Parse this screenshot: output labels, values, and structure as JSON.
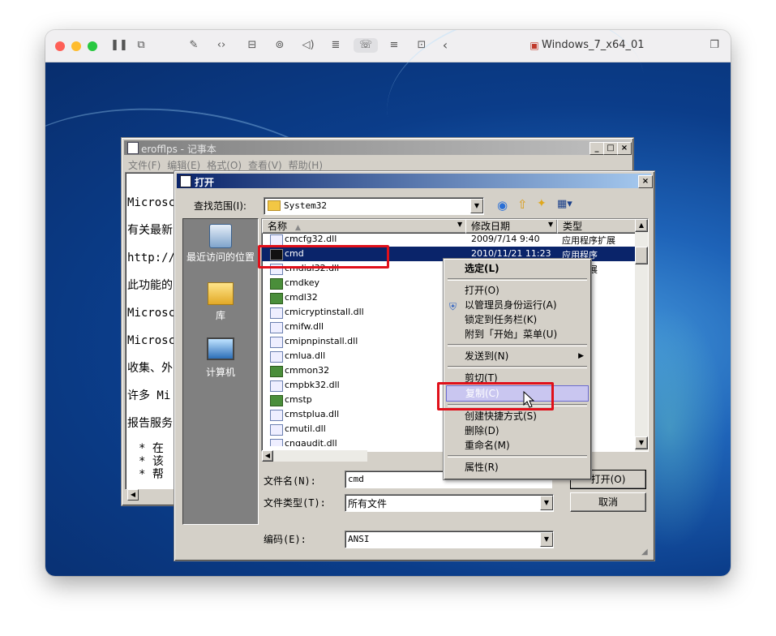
{
  "vm": {
    "title": "Windows_7_x64_01"
  },
  "notepad": {
    "title": "erofflps - 记事本",
    "menu": [
      "文件(F)",
      "编辑(E)",
      "格式(O)",
      "查看(V)",
      "帮助(H)"
    ],
    "lines": [
      "Microsc",
      "有关最新",
      "http://",
      "此功能的",
      "Microsc",
      "Microsc",
      "收集、外",
      "许多 Mi",
      "报告服务"
    ],
    "bullets": [
      "*  在",
      "*  该",
      "*  帮"
    ]
  },
  "dialog": {
    "title": "打开",
    "lookin_label": "查找范围(I):",
    "lookin_value": "System32",
    "places": [
      {
        "label": "最近访问的位置"
      },
      {
        "label": "库"
      },
      {
        "label": "计算机"
      }
    ],
    "columns": {
      "name": "名称",
      "date": "修改日期",
      "type": "类型"
    },
    "files": [
      {
        "name": "cmcfg32.dll",
        "date": "2009/7/14 9:40",
        "type": "应用程序扩展",
        "icon": "dll-icon"
      },
      {
        "name": "cmd",
        "date": "2010/11/21 11:23",
        "type": "应用程序",
        "icon": "cmd-icon",
        "selected": true
      },
      {
        "name": "cmdial32.dll",
        "date": "",
        "type": "程序扩展",
        "icon": "dll-icon"
      },
      {
        "name": "cmdkey",
        "date": "",
        "type": "序",
        "icon": "exe-icon"
      },
      {
        "name": "cmdl32",
        "date": "",
        "type": "序",
        "icon": "exe-icon"
      },
      {
        "name": "cmicryptinstall.dll",
        "date": "",
        "type": "序扩展",
        "icon": "dll-icon"
      },
      {
        "name": "cmifw.dll",
        "date": "",
        "type": "序扩展",
        "icon": "dll-icon"
      },
      {
        "name": "cmipnpinstall.dll",
        "date": "",
        "type": "序扩展",
        "icon": "dll-icon"
      },
      {
        "name": "cmlua.dll",
        "date": "",
        "type": "序扩展",
        "icon": "dll-icon"
      },
      {
        "name": "cmmon32",
        "date": "",
        "type": "序",
        "icon": "exe-icon"
      },
      {
        "name": "cmpbk32.dll",
        "date": "",
        "type": "序扩展",
        "icon": "dll-icon"
      },
      {
        "name": "cmstp",
        "date": "",
        "type": "序",
        "icon": "exe-icon"
      },
      {
        "name": "cmstplua.dll",
        "date": "",
        "type": "序扩展",
        "icon": "dll-icon"
      },
      {
        "name": "cmutil.dll",
        "date": "",
        "type": "序扩展",
        "icon": "dll-icon"
      },
      {
        "name": "cngaudit.dll",
        "date": "",
        "type": "序扩展",
        "icon": "dll-icon"
      }
    ],
    "filename_label": "文件名(N):",
    "filename_value": "cmd",
    "filetype_label": "文件类型(T):",
    "filetype_value": "所有文件",
    "encoding_label": "编码(E):",
    "encoding_value": "ANSI",
    "open_button": "打开(O)",
    "cancel_button": "取消"
  },
  "context_menu": {
    "items": [
      {
        "label": "选定(L)",
        "bold": true
      },
      {
        "sep": true
      },
      {
        "label": "打开(O)"
      },
      {
        "label": "以管理员身份运行(A)",
        "shield": true
      },
      {
        "label": "锁定到任务栏(K)"
      },
      {
        "label": "附到「开始」菜单(U)"
      },
      {
        "sep": true
      },
      {
        "label": "发送到(N)",
        "submenu": true
      },
      {
        "sep": true
      },
      {
        "label": "剪切(T)"
      },
      {
        "label": "复制(C)",
        "highlighted": true
      },
      {
        "sep": true
      },
      {
        "label": "创建快捷方式(S)"
      },
      {
        "label": "删除(D)"
      },
      {
        "label": "重命名(M)"
      },
      {
        "sep": true
      },
      {
        "label": "属性(R)"
      }
    ]
  },
  "colors": {
    "accent": "#0a246a",
    "highlight": "#c9c6f0",
    "annotation": "#e0101a"
  }
}
